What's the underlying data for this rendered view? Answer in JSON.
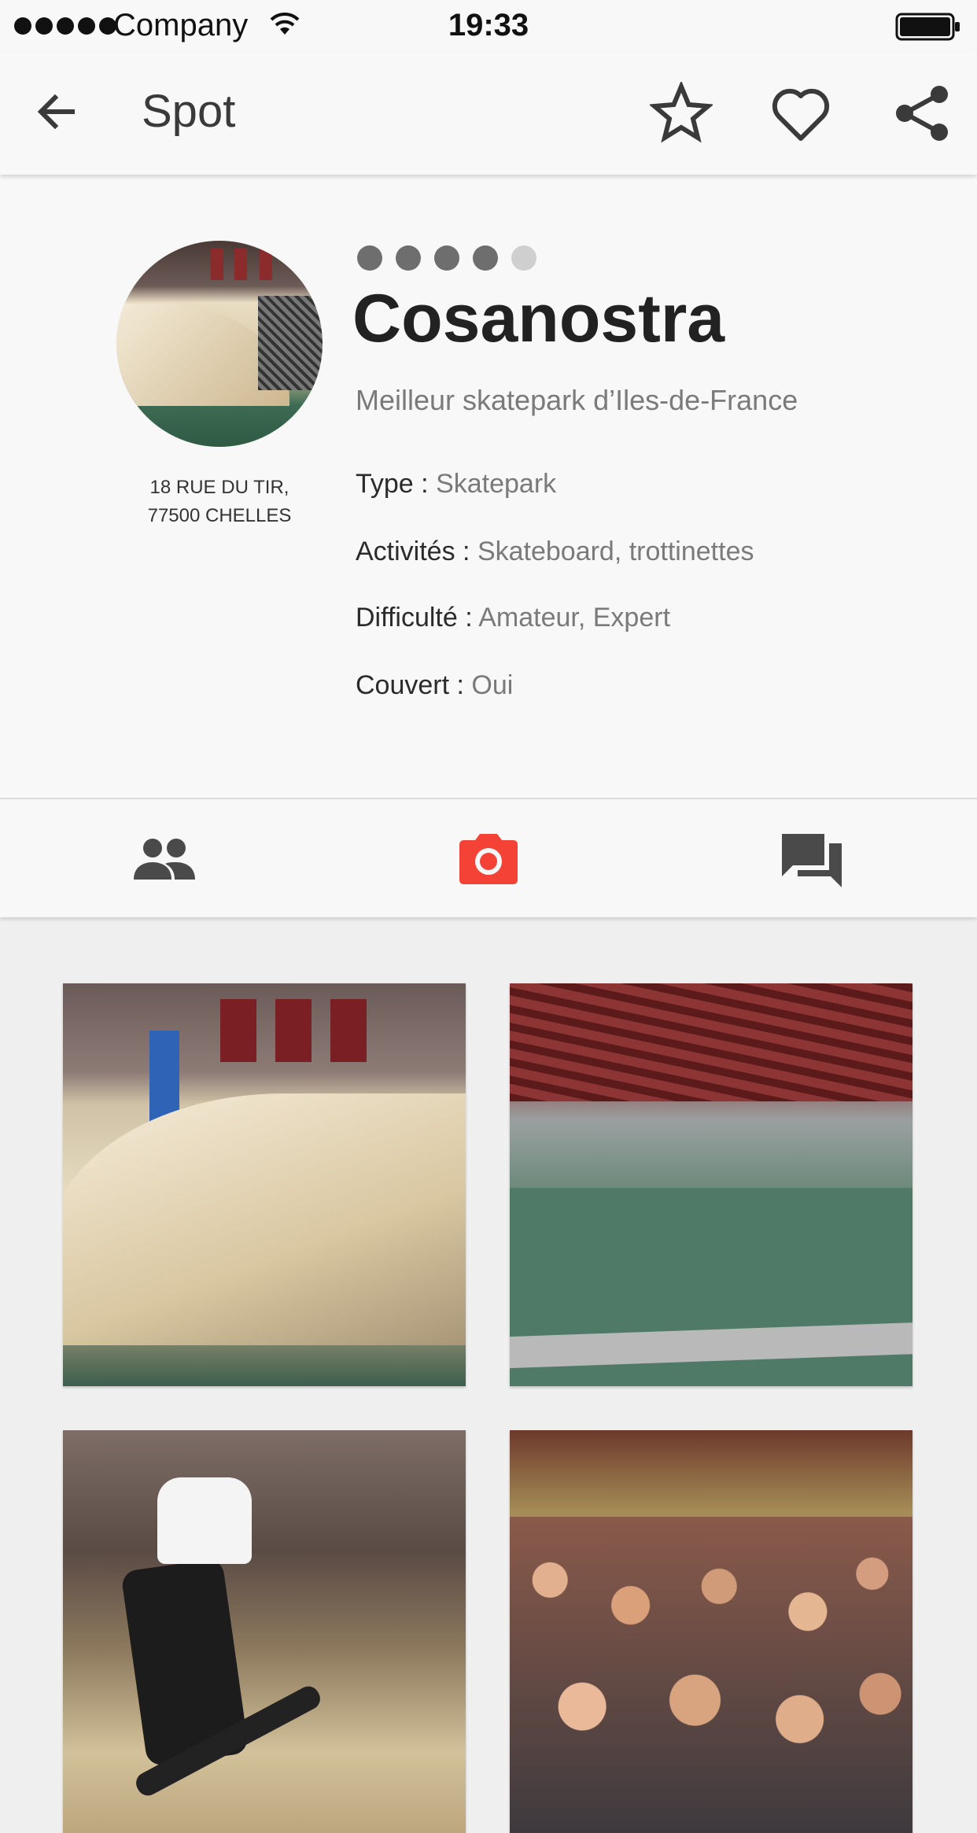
{
  "status_bar": {
    "carrier": "Company",
    "time": "19:33",
    "signal_bars": 5
  },
  "app_bar": {
    "title": "Spot",
    "icons": [
      "back-arrow-icon",
      "star-icon",
      "heart-icon",
      "share-icon"
    ]
  },
  "spot": {
    "difficulty_dots": {
      "filled": 4,
      "total": 5
    },
    "name": "Cosanostra",
    "tagline": "Meilleur skatepark d’Iles-de-France",
    "address_line1": "18 RUE DU TIR,",
    "address_line2": "77500 CHELLES",
    "attributes": [
      {
        "label": "Type",
        "value": "Skatepark"
      },
      {
        "label": "Activités",
        "value": "Skateboard, trottinettes"
      },
      {
        "label": "Difficulté",
        "value": "Amateur, Expert"
      },
      {
        "label": "Couvert",
        "value": "Oui"
      }
    ],
    "separator": " : "
  },
  "tabs": {
    "items": [
      "members-icon",
      "camera-icon",
      "comments-icon"
    ],
    "active": "camera-icon",
    "active_color": "#f44336",
    "inactive_color": "#4a4a4a"
  },
  "photos": {
    "count_visible": 4
  }
}
